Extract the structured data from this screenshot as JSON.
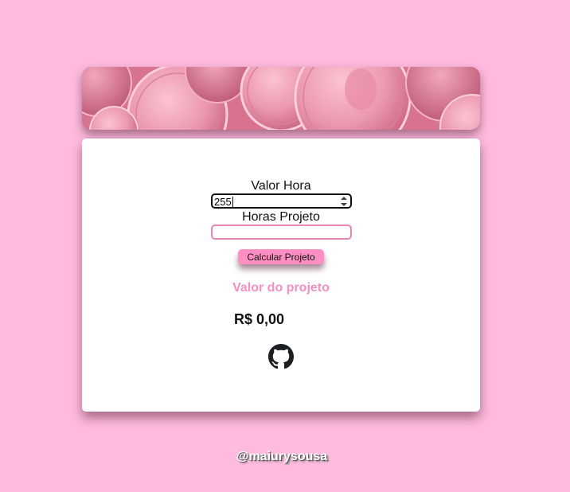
{
  "colors": {
    "page_background": "#ffbbdf",
    "accent_pink": "#ff8fc2",
    "result_title_pink": "#f48fc0",
    "card_background": "#ffffff"
  },
  "banner": {
    "image": "pink-coins-banner"
  },
  "form": {
    "valor_hora_label": "Valor Hora",
    "valor_hora_value": "255",
    "horas_projeto_label": "Horas Projeto",
    "horas_projeto_value": "",
    "calcular_button_label": "Calcular Projeto"
  },
  "result": {
    "title": "Valor do projeto",
    "value": "R$ 0,00"
  },
  "footer": {
    "github_icon": "github-icon",
    "handle": "@maiurysousa"
  }
}
